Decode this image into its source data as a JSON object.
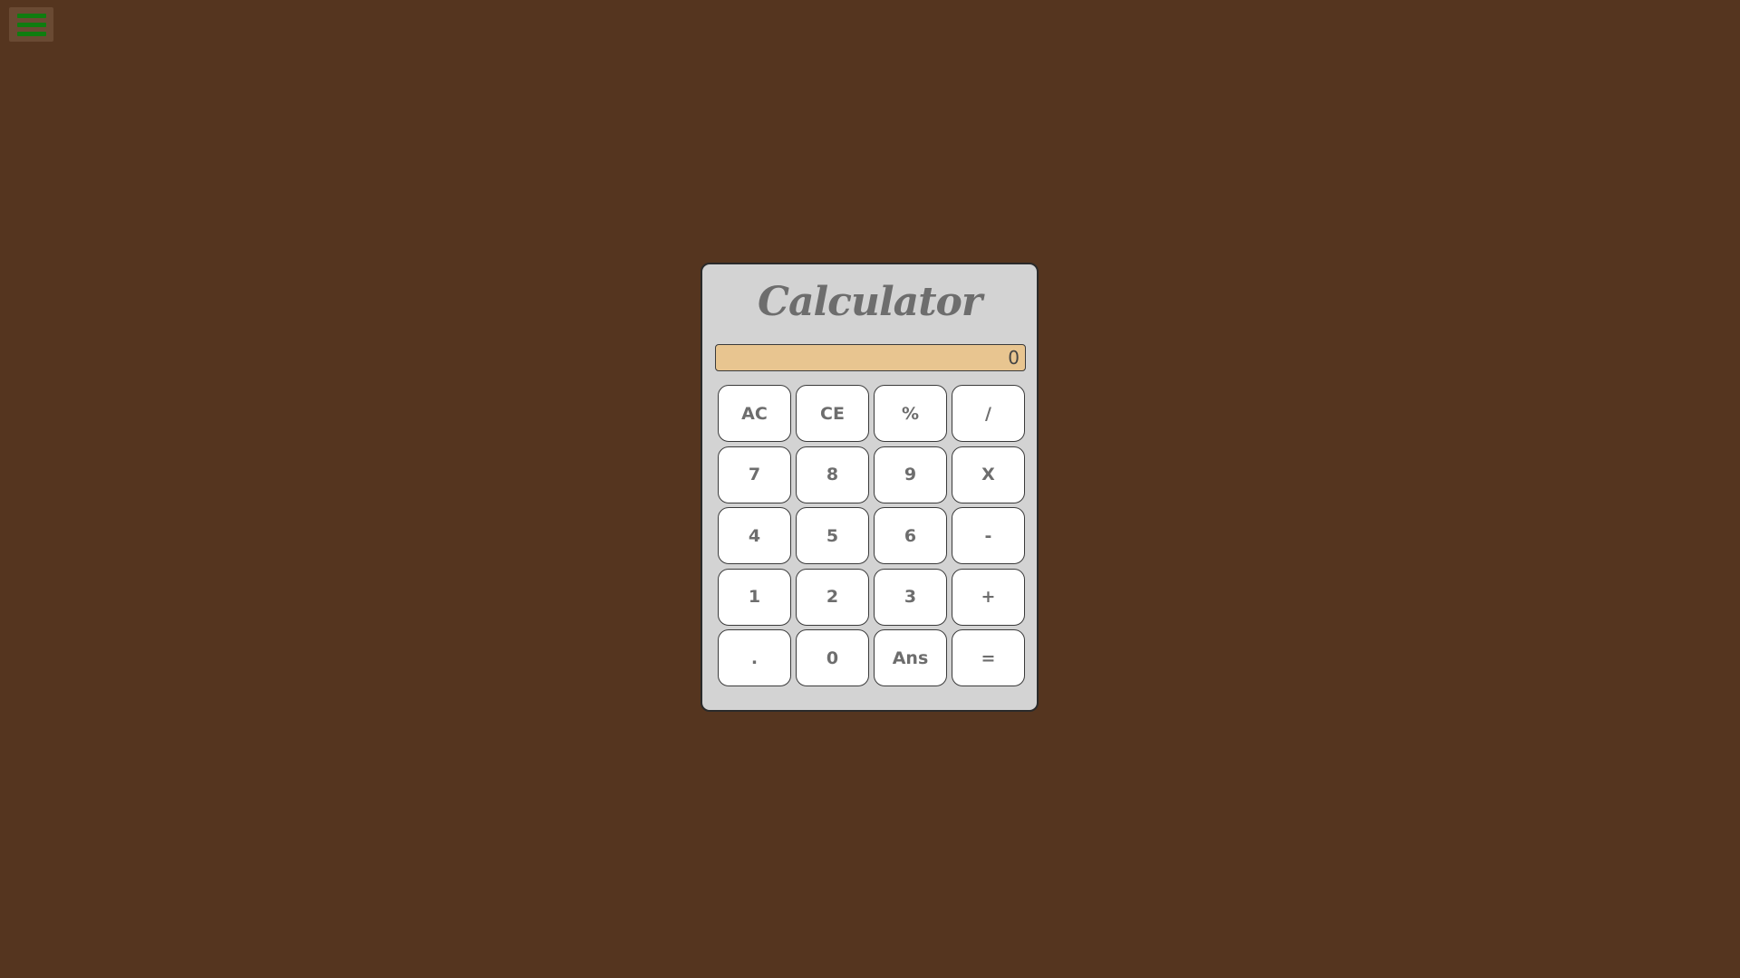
{
  "menu": {
    "icon": "hamburger-menu-icon",
    "color": "#0f7d0f"
  },
  "calculator": {
    "title": "Calculator",
    "display_value": "0",
    "keys": [
      "AC",
      "CE",
      "%",
      "/",
      "7",
      "8",
      "9",
      "X",
      "4",
      "5",
      "6",
      "-",
      "1",
      "2",
      "3",
      "+",
      ".",
      "0",
      "Ans",
      "="
    ]
  },
  "colors": {
    "background": "#55351f",
    "panel": "#d3d3d3",
    "display": "#e8c590",
    "key": "#ffffff",
    "key_text": "#6d6d6d"
  }
}
